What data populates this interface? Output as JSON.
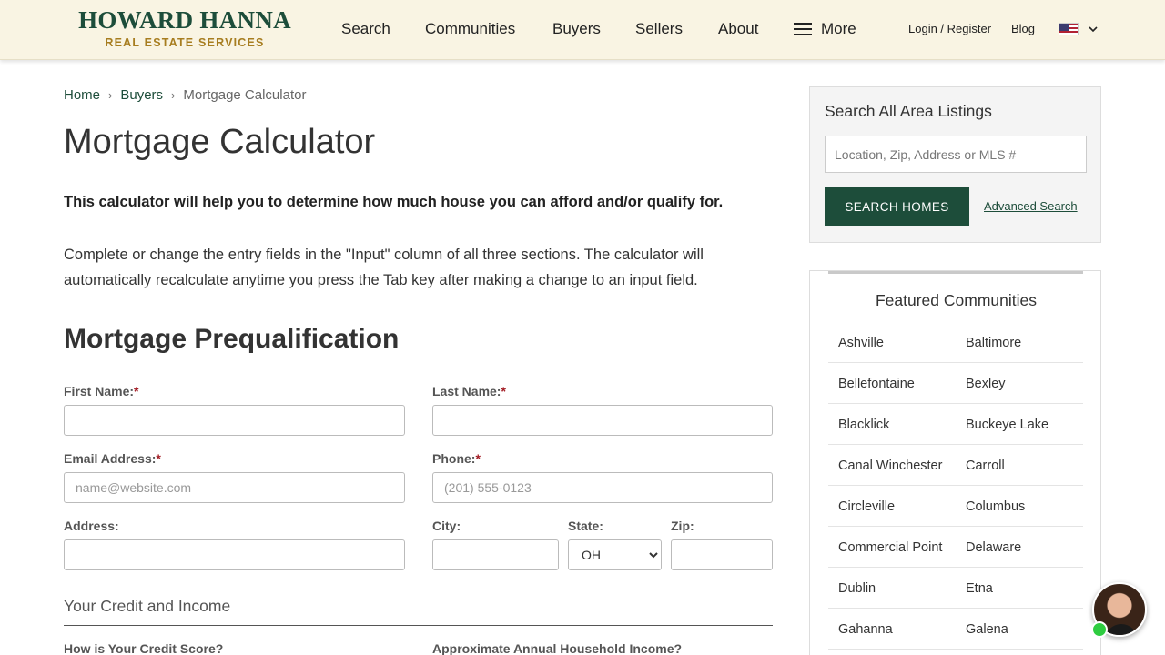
{
  "header": {
    "logo_main": "HOWARD HANNA",
    "logo_sub": "REAL ESTATE SERVICES",
    "nav": [
      "Search",
      "Communities",
      "Buyers",
      "Sellers",
      "About"
    ],
    "more_label": "More",
    "login_label": "Login / Register",
    "blog_label": "Blog"
  },
  "breadcrumb": {
    "home": "Home",
    "buyers": "Buyers",
    "current": "Mortgage Calculator",
    "separator": "›"
  },
  "page": {
    "title": "Mortgage Calculator",
    "intro_bold": "This calculator will help you to determine how much house you can afford and/or qualify for.",
    "intro_text": "Complete or change the entry fields in the \"Input\" column of all three sections. The calculator will automatically recalculate anytime you press the Tab key after making a change to an input field."
  },
  "form": {
    "section_title": "Mortgage Prequalification",
    "required_mark": "*",
    "first_name_label": "First Name:",
    "last_name_label": "Last Name:",
    "email_label": "Email Address:",
    "email_placeholder": "name@website.com",
    "phone_label": "Phone:",
    "phone_placeholder": "(201) 555-0123",
    "address_label": "Address:",
    "city_label": "City:",
    "state_label": "State:",
    "state_value": "OH",
    "zip_label": "Zip:",
    "credit_section_title": "Your Credit and Income",
    "credit_score_label": "How is Your Credit Score?",
    "income_label": "Approximate Annual Household Income?"
  },
  "sidebar": {
    "search_title": "Search All Area Listings",
    "search_placeholder": "Location, Zip, Address or MLS #",
    "search_button": "SEARCH HOMES",
    "advanced_link": "Advanced Search",
    "featured_title": "Featured Communities",
    "communities": [
      [
        "Ashville",
        "Baltimore"
      ],
      [
        "Bellefontaine",
        "Bexley"
      ],
      [
        "Blacklick",
        "Buckeye Lake"
      ],
      [
        "Canal Winchester",
        "Carroll"
      ],
      [
        "Circleville",
        "Columbus"
      ],
      [
        "Commercial Point",
        "Delaware"
      ],
      [
        "Dublin",
        "Etna"
      ],
      [
        "Gahanna",
        "Galena"
      ]
    ]
  },
  "colors": {
    "brand_green": "#1d4d3a",
    "brand_gold": "#a77d20",
    "header_bg": "#f9f4e3",
    "required_red": "#a31c24",
    "online_green": "#2ecc40"
  },
  "icons": {
    "menu": "hamburger-menu-icon",
    "language_flag": "us-flag-icon",
    "dropdown": "chevron-down-icon",
    "chat": "chat-avatar-icon"
  }
}
